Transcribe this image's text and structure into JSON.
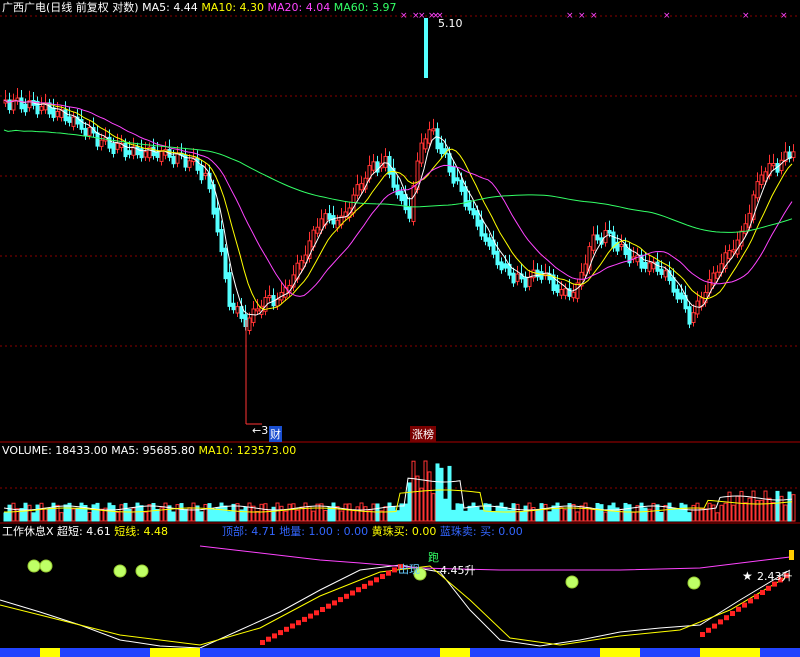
{
  "main": {
    "stock_name": "广西广电",
    "period_label": "(日线 前复权 对数)",
    "ma5_label": "MA5:",
    "ma5_value": "4.44",
    "ma10_label": "MA10:",
    "ma10_value": "4.30",
    "ma20_label": "MA20:",
    "ma20_value": "4.04",
    "ma60_label": "MA60:",
    "ma60_value": "3.97",
    "high_marker": "5.10",
    "low_marker": "3",
    "cai_tag": "财",
    "zhangbang_tag": "涨榜"
  },
  "volume": {
    "label": "VOLUME:",
    "value": "18433.00",
    "ma5_label": "MA5:",
    "ma5_value": "95685.80",
    "ma10_label": "MA10:",
    "ma10_value": "123573.00"
  },
  "indicator": {
    "name": "工作休息X",
    "chaoduan_label": "超短:",
    "chaoduan_value": "4.61",
    "duanxian_label": "短线:",
    "duanxian_value": "4.48",
    "dingbu_label": "顶部:",
    "dingbu_value": "4.71",
    "dibu_label": "地量:",
    "dibu_value": "1.00",
    "colon_value": ": 0.00",
    "huangzhu_label": "黄珠买:",
    "huangzhu_value": "0.00",
    "lanzhu_label": "蓝珠卖:",
    "lanzhu_value": "买: 0.00",
    "sheng_tag_1": "4.45升",
    "sheng_tag_2": "2.43升",
    "pao_tag": "跑",
    "chuxian_tag": "出现"
  },
  "colors": {
    "up": "#ff3333",
    "down": "#54ffff",
    "ma5": "#ffffff",
    "ma10": "#ffff00",
    "ma20": "#ff44ff",
    "ma60": "#33ff66",
    "grid": "#8b0000"
  }
}
